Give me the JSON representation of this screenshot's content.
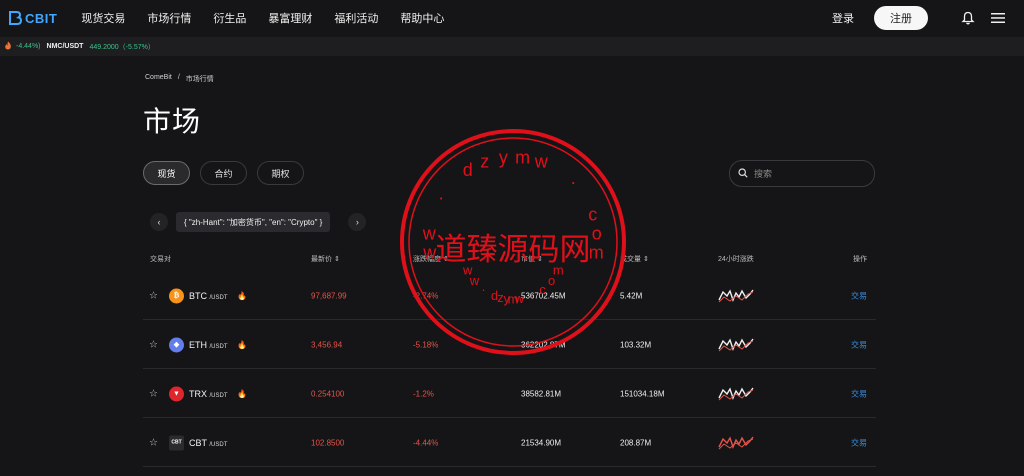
{
  "header": {
    "logo_text": "CBIT",
    "nav": [
      "现货交易",
      "市场行情",
      "衍生品",
      "暴富理财",
      "福利活动",
      "帮助中心"
    ],
    "login": "登录",
    "register": "注册"
  },
  "ticker": {
    "pct1": "-4.44%)",
    "pair": "NMC/USDT",
    "price": "449.2000（-5.57%）"
  },
  "breadcrumb": {
    "home": "ComeBit",
    "sep": "/",
    "current": "市场行情"
  },
  "page_title": "市场",
  "tabs": [
    "现货",
    "合约",
    "期权"
  ],
  "search": {
    "placeholder": "搜索"
  },
  "category": {
    "label": "{ \"zh-Hant\": \"加密货币\", \"en\": \"Crypto\" }",
    "prev": "‹",
    "next": "›"
  },
  "table": {
    "headers": {
      "pair": "交易对",
      "price": "最新价 ⇕",
      "change": "涨跌幅度 ⇕",
      "mcap": "市值 ⇕",
      "volume": "成交量 ⇕",
      "trend": "24小时涨跌",
      "action": "操作"
    },
    "rows": [
      {
        "symbol": "BTC",
        "quote": "/USDT",
        "price": "97,687.99",
        "change": "-2.74%",
        "mcap": "536702.45M",
        "volume": "5.42M",
        "trade": "交易",
        "icon_color": "#f7931a",
        "icon_glyph": "₿",
        "hot": true
      },
      {
        "symbol": "ETH",
        "quote": "/USDT",
        "price": "3,456.94",
        "change": "-5.18%",
        "mcap": "362202.87M",
        "volume": "103.32M",
        "trade": "交易",
        "icon_color": "#627eea",
        "icon_glyph": "◆",
        "hot": true
      },
      {
        "symbol": "TRX",
        "quote": "/USDT",
        "price": "0.254100",
        "change": "-1.2%",
        "mcap": "38582.81M",
        "volume": "151034.18M",
        "trade": "交易",
        "icon_color": "#e0262d",
        "icon_glyph": "▼",
        "hot": true
      },
      {
        "symbol": "CBT",
        "quote": "/USDT",
        "price": "102.8500",
        "change": "-4.44%",
        "mcap": "21534.90M",
        "volume": "208.87M",
        "trade": "交易",
        "icon_color": "#2b2b2f",
        "icon_glyph": "CBT",
        "hot": false
      }
    ]
  },
  "watermark": {
    "text": "道臻源码网",
    "ring_top": "dzymw",
    "ring_bottom": "dzymw"
  },
  "colors": {
    "accent": "#3fa7ff",
    "down": "#e5544b",
    "up": "#3cc28a",
    "link": "#3a8fe0"
  }
}
